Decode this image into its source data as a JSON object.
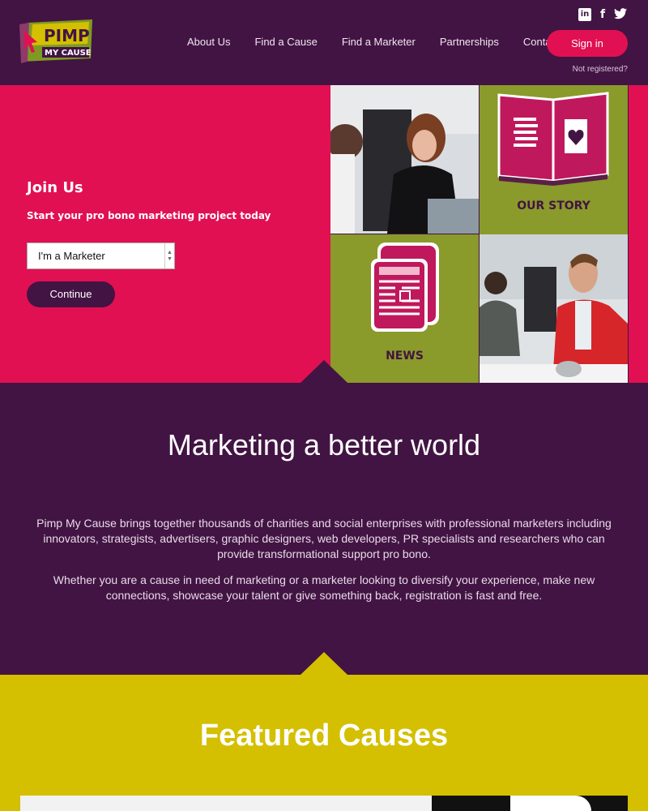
{
  "header": {
    "logo": {
      "line1": "PIMP",
      "line2": "MY CAUSE"
    },
    "social_icons": [
      "linkedin-icon",
      "facebook-icon",
      "twitter-icon"
    ],
    "nav": [
      "About Us",
      "Find a Cause",
      "Find a Marketer",
      "Partnerships",
      "Contact Us"
    ],
    "signin_label": "Sign in",
    "not_registered": "Not registered?"
  },
  "hero": {
    "title": "Join Us",
    "subtitle": "Start your pro bono marketing project today",
    "select_value": "I'm a Marketer",
    "continue_label": "Continue",
    "tiles": {
      "story_label": "OUR STORY",
      "news_label": "NEWS"
    }
  },
  "marketing": {
    "title": "Marketing a better world",
    "p1": "Pimp My Cause brings together thousands of charities and social enterprises with professional marketers including innovators, strategists, advertisers, graphic designers, web developers, PR specialists and researchers who can provide transformational support pro bono.",
    "p2": "Whether you are a cause in need of marketing or a marketer looking to diversify your experience, make new connections, showcase your talent or give something back, registration is fast and free."
  },
  "featured": {
    "title": "Featured Causes"
  },
  "colors": {
    "purple": "#421443",
    "pink": "#e11052",
    "olive": "#8a9a2b",
    "yellow": "#d4bf00"
  }
}
